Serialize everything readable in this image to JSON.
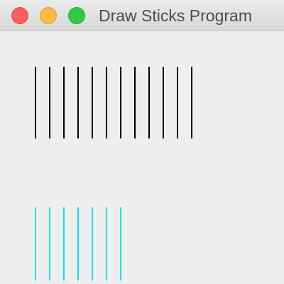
{
  "window": {
    "title": "Draw Sticks Program"
  },
  "sticks": {
    "groups": [
      {
        "count": 12,
        "color": "#000000"
      },
      {
        "count": 7,
        "color": "#00e5ee"
      }
    ]
  }
}
